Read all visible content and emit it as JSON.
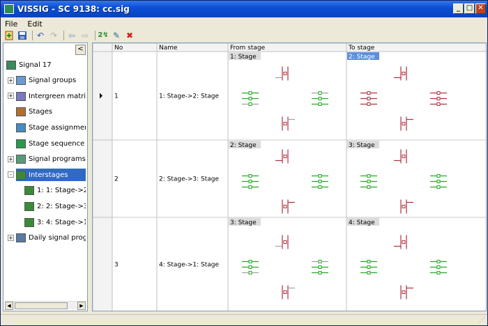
{
  "window": {
    "title": "VISSIG - SC 9138: cc.sig",
    "minimize": "_",
    "maximize": "□",
    "close": "✕"
  },
  "menu": [
    "File",
    "Edit"
  ],
  "toolbar": {
    "icons": [
      "new-icon",
      "save-icon",
      "undo-icon",
      "redo-icon",
      "back-icon",
      "forward-icon",
      "auto-generate-icon",
      "edit-pencil-icon",
      "delete-icon"
    ]
  },
  "tree": {
    "collapse_button": "<",
    "items": [
      {
        "label": "Signal 17",
        "icon": "signal-controller-icon",
        "level": 0,
        "expander": ""
      },
      {
        "label": "Signal groups",
        "icon": "signal-group-icon",
        "level": 1,
        "expander": "+"
      },
      {
        "label": "Intergreen matrice",
        "icon": "matrix-icon",
        "level": 1,
        "expander": "+"
      },
      {
        "label": "Stages",
        "icon": "stages-icon",
        "level": 1,
        "expander": ""
      },
      {
        "label": "Stage assignments",
        "icon": "assignment-icon",
        "level": 1,
        "expander": ""
      },
      {
        "label": "Stage sequence e",
        "icon": "sequence-icon",
        "level": 1,
        "expander": ""
      },
      {
        "label": "Signal programs",
        "icon": "program-icon",
        "level": 1,
        "expander": "+"
      },
      {
        "label": "Interstages",
        "icon": "interstage-icon",
        "level": 1,
        "expander": "-",
        "selected": true
      },
      {
        "label": "1: 1: Stage->2",
        "icon": "interstage-item-icon",
        "level": 2,
        "expander": ""
      },
      {
        "label": "2: 2: Stage->3",
        "icon": "interstage-item-icon",
        "level": 2,
        "expander": ""
      },
      {
        "label": "3: 4: Stage->1",
        "icon": "interstage-item-icon",
        "level": 2,
        "expander": ""
      },
      {
        "label": "Daily signal progra",
        "icon": "daily-program-icon",
        "level": 1,
        "expander": "+"
      }
    ]
  },
  "grid": {
    "columns": [
      "No",
      "Name",
      "From stage",
      "To stage"
    ],
    "rows": [
      {
        "no": "1",
        "name": "1: Stage->2: Stage",
        "from_stage": "1: Stage",
        "to_stage": "2: Stage",
        "current": true,
        "from_green": "ew",
        "to_green": "none"
      },
      {
        "no": "2",
        "name": "2: Stage->3: Stage",
        "from_stage": "2: Stage",
        "to_stage": "3: Stage",
        "current": false,
        "from_green": "mid",
        "to_green": "left"
      },
      {
        "no": "3",
        "name": "4: Stage->1: Stage",
        "from_stage": "3: Stage",
        "to_stage": "4: Stage",
        "current": false,
        "from_green": "ew",
        "to_green": "right"
      }
    ]
  },
  "colors": {
    "green": "#22aa22",
    "red": "#b03040",
    "grey": "#a0a0a0",
    "selected": "#316ac5"
  }
}
